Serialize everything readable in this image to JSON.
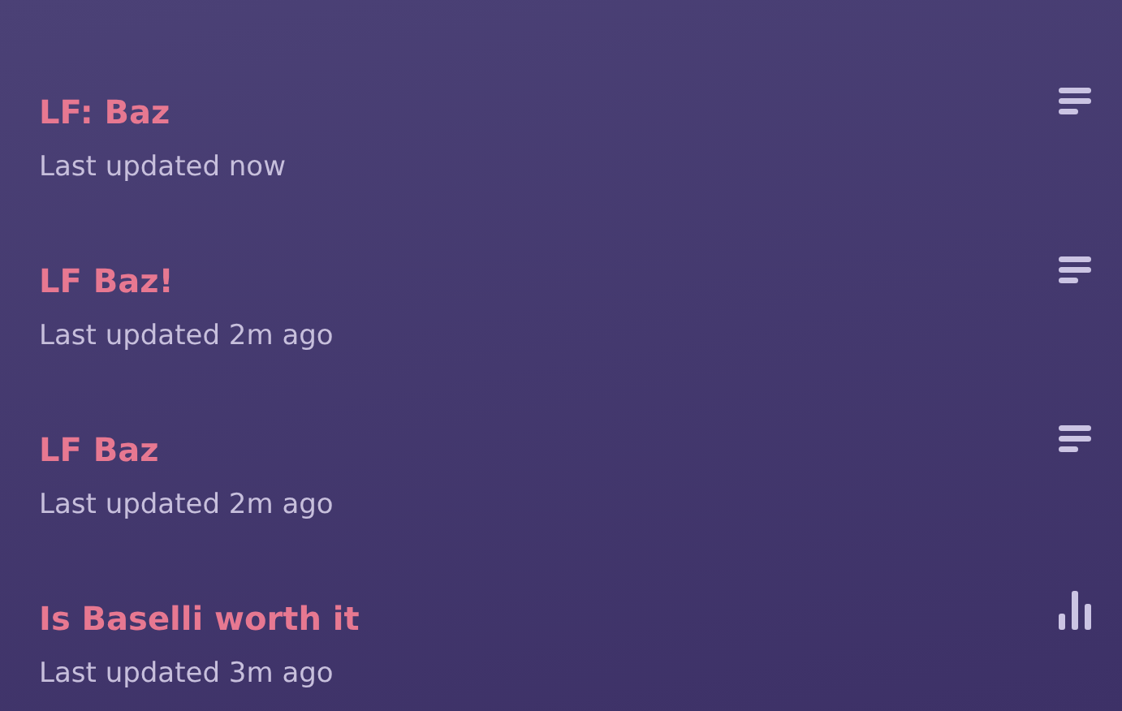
{
  "threads": [
    {
      "title": "LF: Baz",
      "updated": "Last updated now",
      "kind": "text"
    },
    {
      "title": "LF Baz!",
      "updated": "Last updated 2m ago",
      "kind": "text"
    },
    {
      "title": "LF Baz",
      "updated": "Last updated 2m ago",
      "kind": "text"
    },
    {
      "title": "Is Baselli worth it",
      "updated": "Last updated 3m ago",
      "kind": "poll"
    }
  ]
}
